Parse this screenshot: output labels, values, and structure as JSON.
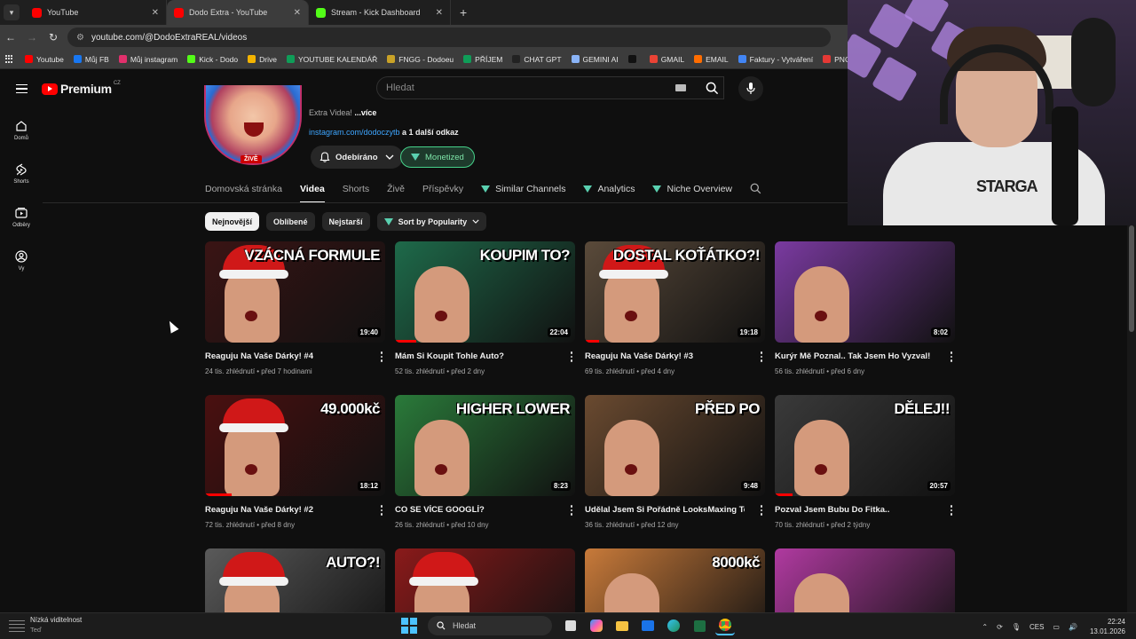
{
  "browser": {
    "tabs": [
      {
        "label": "YouTube",
        "active": false,
        "color": "#ff0000"
      },
      {
        "label": "Dodo Extra - YouTube",
        "active": true,
        "color": "#ff0000"
      },
      {
        "label": "Stream - Kick Dashboard",
        "active": false,
        "color": "#53fc18"
      }
    ],
    "url": "youtube.com/@DodoExtraREAL/videos",
    "bookmarks": [
      {
        "label": "Youtube",
        "color": "#ff0000"
      },
      {
        "label": "Můj FB",
        "color": "#1877f2"
      },
      {
        "label": "Můj instagram",
        "color": "#e1306c"
      },
      {
        "label": "Kick - Dodo",
        "color": "#53fc18"
      },
      {
        "label": "Drive",
        "color": "#f4b400"
      },
      {
        "label": "YOUTUBE KALENDÁŘ",
        "color": "#0f9d58"
      },
      {
        "label": "FNGG - Dodoeu",
        "color": "#c9a227"
      },
      {
        "label": "PŘÍJEM",
        "color": "#0f9d58"
      },
      {
        "label": "CHAT GPT",
        "color": "#222222"
      },
      {
        "label": "GEMINI AI",
        "color": "#8ab4f8"
      },
      {
        "label": "",
        "color": "#111111"
      },
      {
        "label": "GMAIL",
        "color": "#ea4335"
      },
      {
        "label": "EMAIL",
        "color": "#ff6d00"
      },
      {
        "label": "Faktury - Vytváření",
        "color": "#4285f4"
      },
      {
        "label": "PNG to PDF",
        "color": "#e53935"
      }
    ]
  },
  "youtube": {
    "logo_text": "Premium",
    "logo_region": "CZ",
    "search_placeholder": "Hledat",
    "sidebar": [
      {
        "label": "Domů",
        "icon": "home-icon"
      },
      {
        "label": "Shorts",
        "icon": "shorts-icon"
      },
      {
        "label": "Odběry",
        "icon": "subscriptions-icon"
      },
      {
        "label": "Vy",
        "icon": "you-icon"
      }
    ],
    "channel": {
      "live_badge": "ŽIVĚ",
      "desc_text": "Extra Videa! ",
      "desc_more": "...více",
      "link_text": "instagram.com/dodoczytb",
      "link_more": " a 1 další odkaz",
      "subscribe_label": "Odebíráno",
      "monetized_label": "Monetized"
    },
    "tabs": [
      {
        "label": "Domovská stránka",
        "active": false,
        "vidiq": false
      },
      {
        "label": "Videa",
        "active": true,
        "vidiq": false
      },
      {
        "label": "Shorts",
        "active": false,
        "vidiq": false
      },
      {
        "label": "Živě",
        "active": false,
        "vidiq": false
      },
      {
        "label": "Příspěvky",
        "active": false,
        "vidiq": false
      },
      {
        "label": "Similar Channels",
        "active": false,
        "vidiq": true
      },
      {
        "label": "Analytics",
        "active": false,
        "vidiq": true
      },
      {
        "label": "Niche Overview",
        "active": false,
        "vidiq": true
      }
    ],
    "chips": [
      {
        "label": "Nejnovější",
        "selected": true
      },
      {
        "label": "Oblíbené",
        "selected": false
      },
      {
        "label": "Nejstarší",
        "selected": false
      }
    ],
    "sort_label": "Sort by Popularity",
    "videos": [
      {
        "title": "Reaguju Na Vaše Dárky! #4",
        "views": "24 tis. zhlédnutí",
        "age": "před 7 hodinami",
        "duration": "19:40",
        "thumb_text": "VZÁCNÁ FORMULE",
        "bg": "#3a1414",
        "progress": 0
      },
      {
        "title": "Mám Si Koupit Tohle Auto?",
        "views": "52 tis. zhlédnutí",
        "age": "před 2 dny",
        "duration": "22:04",
        "thumb_text": "KOUPIM TO?",
        "bg": "#1e6a4a",
        "progress": 0.12
      },
      {
        "title": "Reaguju Na Vaše Dárky! #3",
        "views": "69 tis. zhlédnutí",
        "age": "před 4 dny",
        "duration": "19:18",
        "thumb_text": "DOSTAL KOŤÁTKO?!",
        "bg": "#5a4a3a",
        "progress": 0.08
      },
      {
        "title": "Kurýr Mě Poznal.. Tak Jsem Ho Vyzval!",
        "views": "56 tis. zhlédnutí",
        "age": "před 6 dny",
        "duration": "8:02",
        "thumb_text": "",
        "bg": "#7a3aa0",
        "progress": 0
      },
      {
        "title": "Reaguju Na Vaše Dárky! #2",
        "views": "72 tis. zhlédnutí",
        "age": "před 8 dny",
        "duration": "18:12",
        "thumb_text": "49.000kč",
        "bg": "#4a1010",
        "progress": 0.15
      },
      {
        "title": "CO SE VÍCE GOOGLÍ?",
        "views": "26 tis. zhlédnutí",
        "age": "před 10 dny",
        "duration": "8:23",
        "thumb_text": "HIGHER LOWER",
        "bg": "#2a7a3a",
        "progress": 0
      },
      {
        "title": "Udělal Jsem Si Pořádně LooksMaxing Test..",
        "views": "36 tis. zhlédnutí",
        "age": "před 12 dny",
        "duration": "9:48",
        "thumb_text": "PŘED      PO",
        "bg": "#6a4a30",
        "progress": 0
      },
      {
        "title": "Pozval Jsem Bubu Do Fitka..",
        "views": "70 tis. zhlédnutí",
        "age": "před 2 týdny",
        "duration": "20:57",
        "thumb_text": "DĚLEJ!!",
        "bg": "#3a3a3a",
        "progress": 0.1
      },
      {
        "title": "",
        "views": "",
        "age": "",
        "duration": "",
        "thumb_text": "AUTO?!",
        "bg": "#5a5a5a",
        "progress": 0
      },
      {
        "title": "",
        "views": "",
        "age": "",
        "duration": "",
        "thumb_text": "",
        "bg": "#8a1a1a",
        "progress": 0
      },
      {
        "title": "",
        "views": "",
        "age": "",
        "duration": "",
        "thumb_text": "8000kč",
        "bg": "#c87a3a",
        "progress": 0
      },
      {
        "title": "",
        "views": "",
        "age": "",
        "duration": "",
        "thumb_text": "",
        "bg": "#b03aa0",
        "progress": 0
      }
    ]
  },
  "webcam": {
    "shirt_text": "STARGA"
  },
  "taskbar": {
    "weather_title": "Nízká viditelnost",
    "weather_sub": "Teď",
    "search_placeholder": "Hledat",
    "lang": "CES",
    "time": "22:24",
    "date": "13.01.2026"
  }
}
